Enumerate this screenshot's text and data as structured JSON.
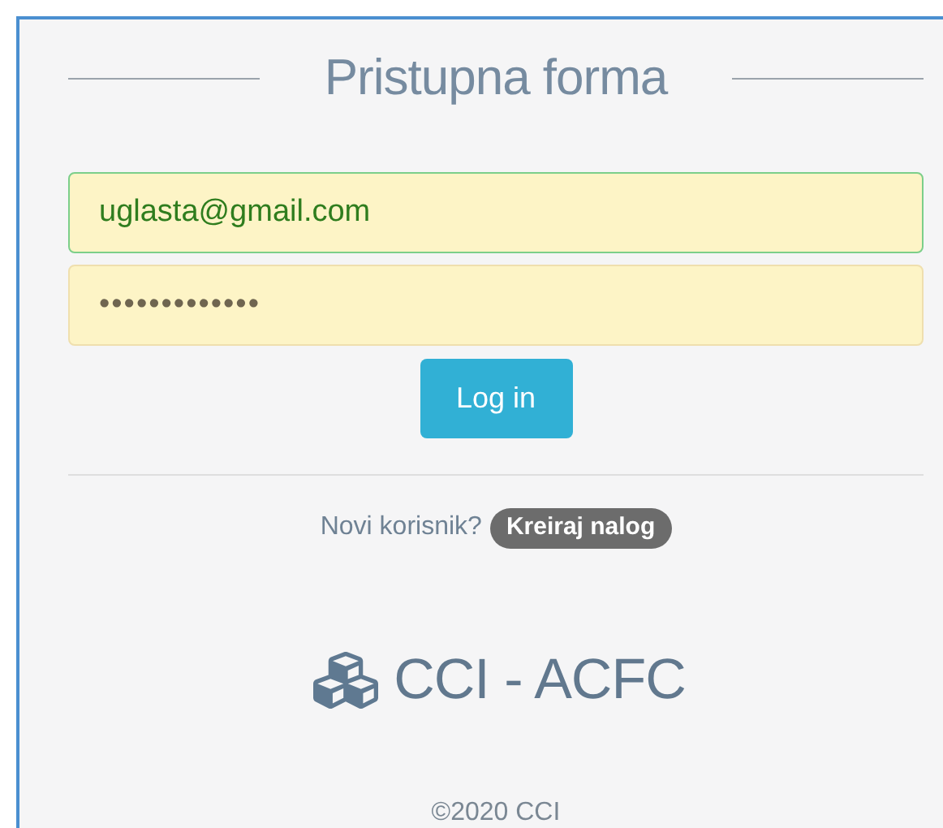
{
  "title": "Pristupna forma",
  "email_field": {
    "value": "uglasta@gmail.com"
  },
  "password_field": {
    "value": "•••••••••••••"
  },
  "login_button": "Log in",
  "signup_prompt": "Novi korisnik?",
  "signup_badge": "Kreiraj nalog",
  "logo_text": "CCI - ACFC",
  "footer": "©2020 CCI"
}
